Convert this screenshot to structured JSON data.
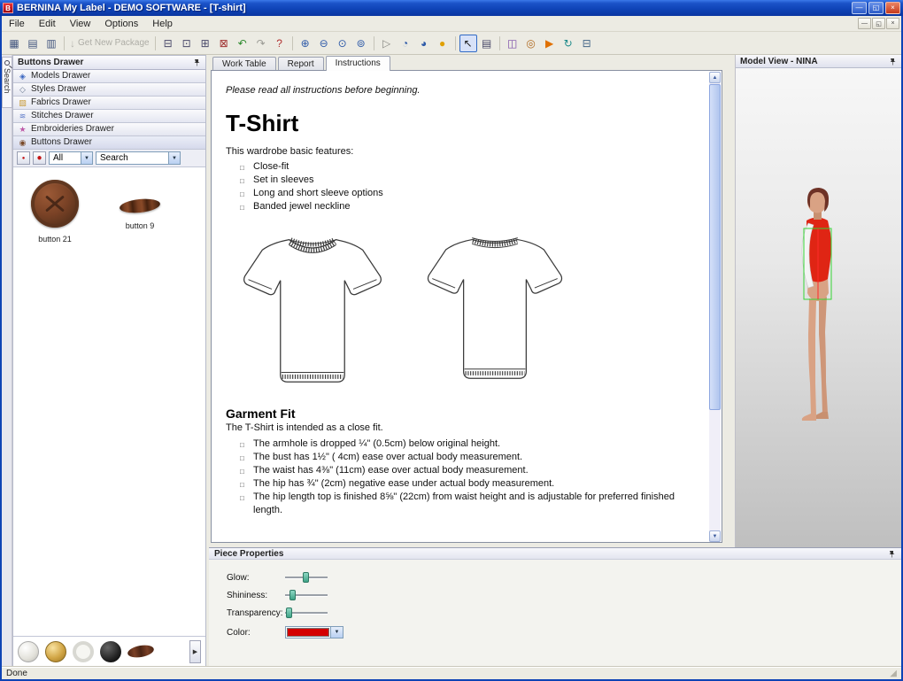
{
  "window": {
    "title": "BERNINA My Label - DEMO SOFTWARE - [T-shirt]",
    "status_text": "Done",
    "controls": [
      {
        "name": "minimize-button",
        "glyph": "—",
        "cls": "min"
      },
      {
        "name": "restore-button",
        "glyph": "◱",
        "cls": "max"
      },
      {
        "name": "close-button",
        "glyph": "×",
        "cls": "close"
      }
    ],
    "mdi_controls": [
      {
        "name": "mdi-minimize-button",
        "glyph": "—"
      },
      {
        "name": "mdi-restore-button",
        "glyph": "◱"
      },
      {
        "name": "mdi-close-button",
        "glyph": "×"
      }
    ]
  },
  "menu": {
    "items": [
      {
        "name": "menu-file",
        "label": "File"
      },
      {
        "name": "menu-edit",
        "label": "Edit"
      },
      {
        "name": "menu-view",
        "label": "View"
      },
      {
        "name": "menu-options",
        "label": "Options"
      },
      {
        "name": "menu-help",
        "label": "Help"
      }
    ]
  },
  "toolbar": {
    "buttons": [
      {
        "name": "worktable-icon-1",
        "glyph": "▦",
        "color": "#44577F",
        "inter": "true"
      },
      {
        "name": "worktable-icon-2",
        "glyph": "▤",
        "color": "#44577F",
        "inter": "true"
      },
      {
        "name": "worktable-icon-3",
        "glyph": "▥",
        "color": "#44577F",
        "inter": "true"
      },
      {
        "name": "toolbar-separator",
        "type": "sep",
        "inter": "false"
      },
      {
        "name": "get-new-package-button",
        "glyph": "↓",
        "label": "Get New Package",
        "type": "disabled",
        "color": "#8A8A84",
        "inter": "true"
      },
      {
        "name": "toolbar-separator",
        "type": "sep",
        "inter": "false"
      },
      {
        "name": "print-button",
        "glyph": "⊟",
        "color": "#4A4A6A",
        "inter": "true"
      },
      {
        "name": "page-setup-button",
        "glyph": "⊡",
        "color": "#4A4A6A",
        "inter": "true"
      },
      {
        "name": "export-button",
        "glyph": "⊞",
        "color": "#4A4A6A",
        "inter": "true"
      },
      {
        "name": "delete-button",
        "glyph": "⊠",
        "color": "#A03030",
        "inter": "true"
      },
      {
        "name": "undo-button",
        "glyph": "↶",
        "color": "#2E8B2E",
        "inter": "true"
      },
      {
        "name": "redo-button",
        "glyph": "↷",
        "color": "#9A9A94",
        "inter": "true"
      },
      {
        "name": "help-button",
        "glyph": "?",
        "color": "#B03030",
        "inter": "true"
      },
      {
        "name": "toolbar-separator",
        "type": "sep",
        "inter": "false"
      },
      {
        "name": "zoom-in-button",
        "glyph": "⊕",
        "color": "#2E5AA8",
        "inter": "true"
      },
      {
        "name": "zoom-out-button",
        "glyph": "⊖",
        "color": "#2E5AA8",
        "inter": "true"
      },
      {
        "name": "zoom-all-button",
        "glyph": "⊙",
        "color": "#2E5AA8",
        "inter": "true"
      },
      {
        "name": "zoom-selection-button",
        "glyph": "⊚",
        "color": "#2E5AA8",
        "inter": "true"
      },
      {
        "name": "toolbar-separator",
        "type": "sep",
        "inter": "false"
      },
      {
        "name": "walk-button",
        "glyph": "▷",
        "color": "#8A8A84",
        "inter": "true"
      },
      {
        "name": "rotate-left-button",
        "glyph": "◔",
        "color": "#2E5AA8",
        "inter": "true"
      },
      {
        "name": "rotate-right-button",
        "glyph": "◕",
        "color": "#2E5AA8",
        "inter": "true"
      },
      {
        "name": "light-button",
        "glyph": "●",
        "color": "#E0A000",
        "inter": "true"
      },
      {
        "name": "toolbar-separator",
        "type": "sep",
        "inter": "false"
      },
      {
        "name": "select-tool-button",
        "glyph": "↖",
        "color": "#1A1A1A",
        "type": "selected",
        "inter": "true"
      },
      {
        "name": "stitch-tool-button",
        "glyph": "▤",
        "color": "#4A4A6A",
        "inter": "true"
      },
      {
        "name": "toolbar-separator",
        "type": "sep",
        "inter": "false"
      },
      {
        "name": "measure-button",
        "glyph": "◫",
        "color": "#7A4AA8",
        "inter": "true"
      },
      {
        "name": "spool-button",
        "glyph": "◎",
        "color": "#B06A20",
        "inter": "true"
      },
      {
        "name": "simulate-button",
        "glyph": "▶",
        "color": "#E07000",
        "inter": "true"
      },
      {
        "name": "refresh-button",
        "glyph": "↻",
        "color": "#1E8A8A",
        "inter": "true"
      },
      {
        "name": "print-3d-button",
        "glyph": "⊟",
        "color": "#446688",
        "inter": "true"
      }
    ]
  },
  "search_strip": {
    "label": "Search"
  },
  "left_panel": {
    "header": "Buttons Drawer",
    "drawers": [
      {
        "name": "drawer-models",
        "icon": "◈",
        "color": "#3A66C0",
        "label": "Models Drawer",
        "inter": "true"
      },
      {
        "name": "drawer-styles",
        "icon": "◇",
        "color": "#6C7A92",
        "label": "Styles Drawer",
        "inter": "true"
      },
      {
        "name": "drawer-fabrics",
        "icon": "▨",
        "color": "#C79B3B",
        "label": "Fabrics Drawer",
        "inter": "true"
      },
      {
        "name": "drawer-stitches",
        "icon": "≋",
        "color": "#5A78C8",
        "label": "Stitches Drawer",
        "inter": "true"
      },
      {
        "name": "drawer-embroideries",
        "icon": "★",
        "color": "#BE5AA8",
        "label": "Embroideries Drawer",
        "inter": "true"
      },
      {
        "name": "drawer-buttons",
        "icon": "◉",
        "color": "#7A4A2A",
        "label": "Buttons Drawer",
        "cls": "active",
        "inter": "true"
      }
    ],
    "filter": {
      "all_label": "All",
      "search_label": "Search"
    },
    "thumbnails": [
      {
        "name": "button-21-thumbnail",
        "label": "button 21"
      },
      {
        "name": "button-9-thumbnail",
        "label": "button 9"
      }
    ],
    "strip_thumbs": [
      {
        "name": "strip-button-pearl",
        "cls": "pearl",
        "inter": "true"
      },
      {
        "name": "strip-button-gold",
        "cls": "gold",
        "inter": "true"
      },
      {
        "name": "strip-button-white",
        "cls": "ring",
        "inter": "true"
      },
      {
        "name": "strip-button-black",
        "cls": "black",
        "inter": "true"
      },
      {
        "name": "strip-button-toggle",
        "cls": "toggle",
        "inter": "true"
      }
    ]
  },
  "main": {
    "tabs": [
      {
        "name": "tab-work-table",
        "label": "Work Table",
        "inter": "true"
      },
      {
        "name": "tab-report",
        "label": "Report",
        "inter": "true"
      },
      {
        "name": "tab-instructions",
        "label": "Instructions",
        "cls": "active",
        "inter": "true"
      }
    ],
    "instructions": {
      "intro": "Please read all instructions before beginning.",
      "title": "T-Shirt",
      "features_heading": "This wardrobe basic features:",
      "features": [
        "Close-fit",
        "Set in sleeves",
        "Long and short sleeve options",
        "Banded jewel neckline"
      ],
      "fit_heading": "Garment Fit",
      "fit_intro": "The T-Shirt is intended as a close fit.",
      "fit_items": [
        "The armhole is dropped ¼\" (0.5cm) below original height.",
        "The bust has 1½\" ( 4cm) ease over actual body measurement.",
        "The waist has 4⅜\" (11cm) ease over actual body measurement.",
        "The hip has ¾\" (2cm) negative ease under actual body measurement.",
        "The hip length top is finished 8⅝\" (22cm) from waist height and is adjustable for preferred finished length."
      ]
    }
  },
  "model_view": {
    "header": "Model View - NINA"
  },
  "piece_properties": {
    "header": "Piece Properties",
    "sliders": [
      {
        "name": "glow-slider",
        "label": "Glow:",
        "pos": "42%",
        "inter": "true"
      },
      {
        "name": "shininess-slider",
        "label": "Shininess:",
        "pos": "10%",
        "inter": "true"
      },
      {
        "name": "transparency-slider",
        "label": "Transparency:",
        "pos": "2%",
        "inter": "true"
      }
    ],
    "color_label": "Color:",
    "color_value": "#D40000"
  }
}
